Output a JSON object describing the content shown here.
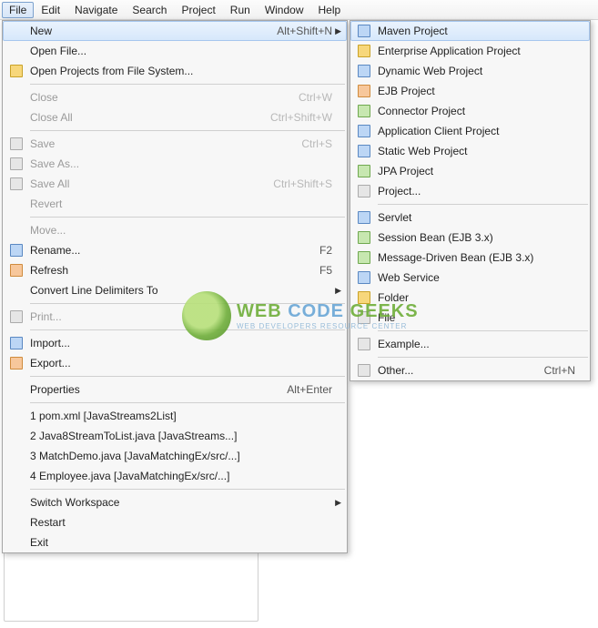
{
  "menubar": [
    "File",
    "Edit",
    "Navigate",
    "Search",
    "Project",
    "Run",
    "Window",
    "Help"
  ],
  "fileMenu": {
    "groups": [
      [
        {
          "label": "New",
          "shortcut": "Alt+Shift+N",
          "submenu": true,
          "highlight": true,
          "icon": "none"
        },
        {
          "label": "Open File...",
          "icon": "none"
        },
        {
          "label": "Open Projects from File System...",
          "icon": "folder"
        }
      ],
      [
        {
          "label": "Close",
          "shortcut": "Ctrl+W",
          "disabled": true,
          "icon": "none"
        },
        {
          "label": "Close All",
          "shortcut": "Ctrl+Shift+W",
          "disabled": true,
          "icon": "none"
        }
      ],
      [
        {
          "label": "Save",
          "shortcut": "Ctrl+S",
          "disabled": true,
          "icon": "gray"
        },
        {
          "label": "Save As...",
          "disabled": true,
          "icon": "gray"
        },
        {
          "label": "Save All",
          "shortcut": "Ctrl+Shift+S",
          "disabled": true,
          "icon": "gray"
        },
        {
          "label": "Revert",
          "disabled": true,
          "icon": "none"
        }
      ],
      [
        {
          "label": "Move...",
          "disabled": true,
          "icon": "none"
        },
        {
          "label": "Rename...",
          "shortcut": "F2",
          "icon": "blue"
        },
        {
          "label": "Refresh",
          "shortcut": "F5",
          "icon": "orange"
        },
        {
          "label": "Convert Line Delimiters To",
          "submenu": true,
          "icon": "none"
        }
      ],
      [
        {
          "label": "Print...",
          "disabled": true,
          "icon": "gray"
        }
      ],
      [
        {
          "label": "Import...",
          "icon": "blue"
        },
        {
          "label": "Export...",
          "icon": "orange"
        }
      ],
      [
        {
          "label": "Properties",
          "shortcut": "Alt+Enter",
          "icon": "none"
        }
      ],
      [
        {
          "label": "1 pom.xml  [JavaStreams2List]",
          "icon": "none"
        },
        {
          "label": "2 Java8StreamToList.java  [JavaStreams...]",
          "icon": "none"
        },
        {
          "label": "3 MatchDemo.java  [JavaMatchingEx/src/...]",
          "icon": "none"
        },
        {
          "label": "4 Employee.java  [JavaMatchingEx/src/...]",
          "icon": "none"
        }
      ],
      [
        {
          "label": "Switch Workspace",
          "submenu": true,
          "icon": "none"
        },
        {
          "label": "Restart",
          "icon": "none"
        },
        {
          "label": "Exit",
          "icon": "none"
        }
      ]
    ]
  },
  "newMenu": {
    "groups": [
      [
        {
          "label": "Maven Project",
          "highlight": true,
          "icon": "blue"
        },
        {
          "label": "Enterprise Application Project",
          "icon": "folder"
        },
        {
          "label": "Dynamic Web Project",
          "icon": "blue"
        },
        {
          "label": "EJB Project",
          "icon": "orange"
        },
        {
          "label": "Connector Project",
          "icon": "green"
        },
        {
          "label": "Application Client Project",
          "icon": "blue"
        },
        {
          "label": "Static Web Project",
          "icon": "blue"
        },
        {
          "label": "JPA Project",
          "icon": "green"
        },
        {
          "label": "Project...",
          "icon": "gray"
        }
      ],
      [
        {
          "label": "Servlet",
          "icon": "blue"
        },
        {
          "label": "Session Bean (EJB 3.x)",
          "icon": "green"
        },
        {
          "label": "Message-Driven Bean (EJB 3.x)",
          "icon": "green"
        },
        {
          "label": "Web Service",
          "icon": "blue"
        },
        {
          "label": "Folder",
          "icon": "folder"
        },
        {
          "label": "File",
          "icon": "gray"
        }
      ],
      [
        {
          "label": "Example...",
          "icon": "gray"
        }
      ],
      [
        {
          "label": "Other...",
          "shortcut": "Ctrl+N",
          "icon": "gray"
        }
      ]
    ]
  },
  "watermark": {
    "line1_a": "WEB ",
    "line1_b": "CODE ",
    "line1_c": "GEEKS",
    "line2": "WEB DEVELOPERS RESOURCE CENTER"
  }
}
